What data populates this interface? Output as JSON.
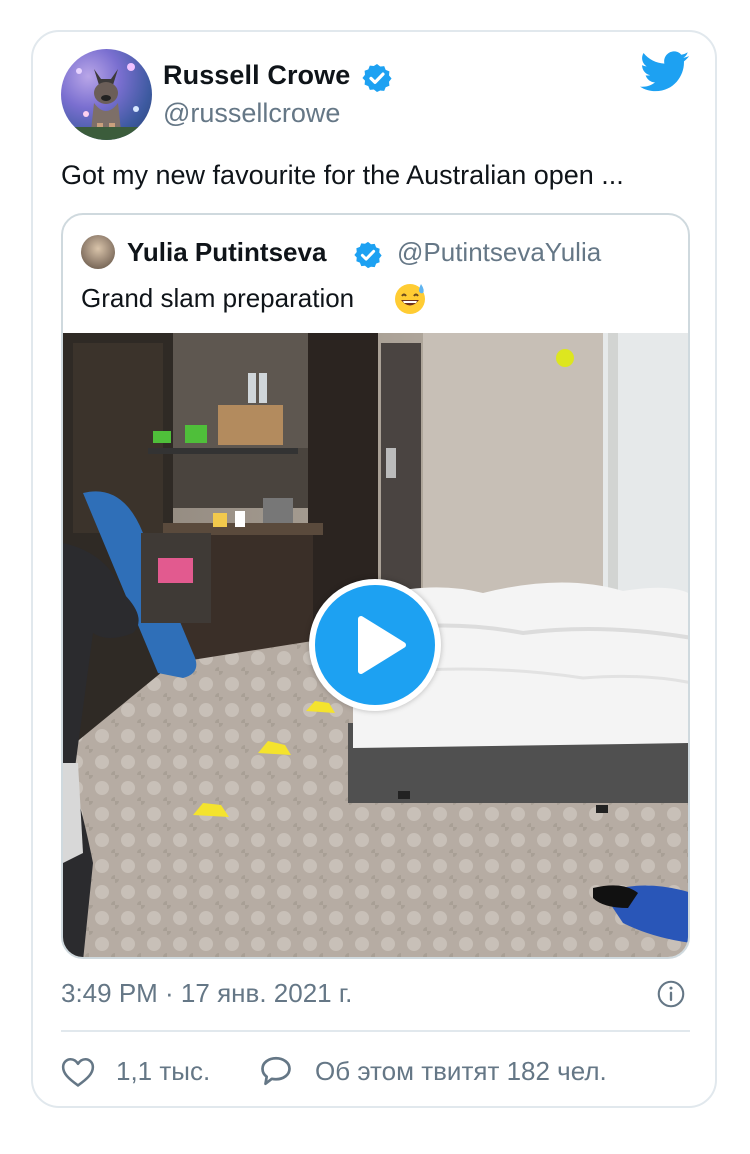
{
  "tweet": {
    "author": {
      "name": "Russell Crowe",
      "handle": "@russellcrowe",
      "verified": true
    },
    "text": "Got my new favourite for the Australian open ...",
    "quoted_tweet": {
      "author": {
        "name": "Yulia Putintseva",
        "handle": "@PutintsevaYulia",
        "verified": true
      },
      "text": "Grand slam preparation",
      "emoji": "sweat-smile-emoji",
      "media": {
        "type": "video",
        "play_icon": "play-icon"
      }
    },
    "timestamp": "3:49 PM · 17 янв. 2021 г.",
    "likes": "1,1 тыс.",
    "replies_text": "Об этом твитят 182 чел."
  },
  "icons": {
    "brand": "twitter-bird-icon",
    "verified": "verified-badge-icon",
    "info": "info-icon",
    "like": "heart-icon",
    "reply": "speech-bubble-icon"
  },
  "colors": {
    "twitter_blue": "#1da1f2",
    "text_primary": "#0f1419",
    "text_secondary": "#657786",
    "border": "#e1e8ed"
  }
}
